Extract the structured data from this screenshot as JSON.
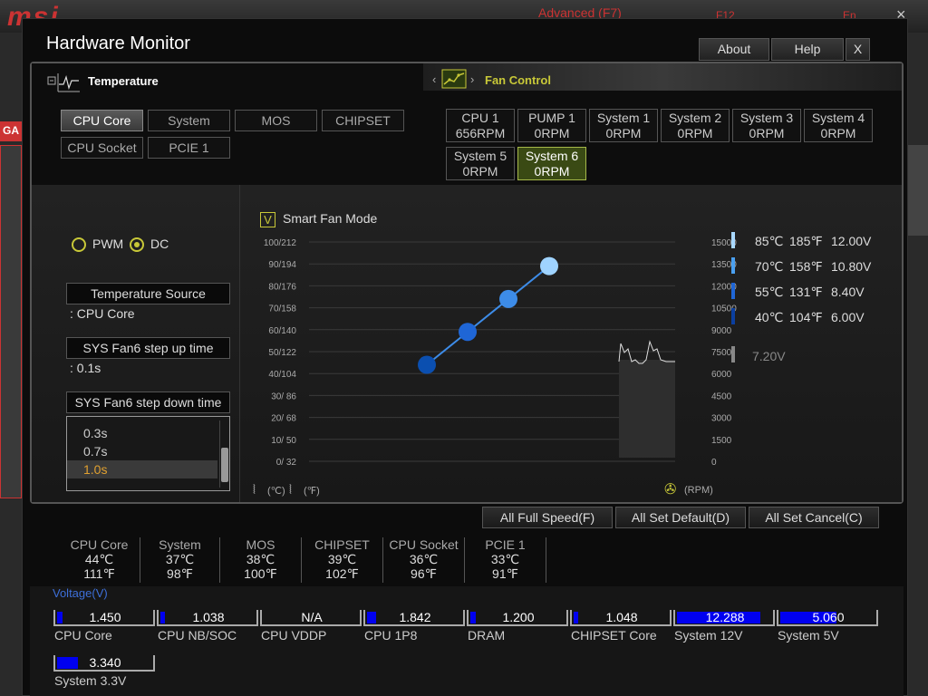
{
  "background_app": {
    "logo": "msi",
    "mode_label": "Advanced (F7)",
    "f12_label": "F12",
    "lang_label": "En",
    "close_label": "×",
    "left_badge": "GA"
  },
  "dialog": {
    "title": "Hardware Monitor",
    "about_label": "About",
    "help_label": "Help",
    "close_label": "X"
  },
  "tabs": {
    "temperature_label": "Temperature",
    "fan_control_label": "Fan Control"
  },
  "sensor_buttons": [
    {
      "label": "CPU Core",
      "selected": true
    },
    {
      "label": "System",
      "selected": false
    },
    {
      "label": "MOS",
      "selected": false
    },
    {
      "label": "CHIPSET",
      "selected": false
    },
    {
      "label": "CPU Socket",
      "selected": false
    },
    {
      "label": "PCIE 1",
      "selected": false
    }
  ],
  "fans": [
    {
      "name": "CPU 1",
      "rpm": "656RPM",
      "selected": false
    },
    {
      "name": "PUMP 1",
      "rpm": "0RPM",
      "selected": false
    },
    {
      "name": "System 1",
      "rpm": "0RPM",
      "selected": false
    },
    {
      "name": "System 2",
      "rpm": "0RPM",
      "selected": false
    },
    {
      "name": "System 3",
      "rpm": "0RPM",
      "selected": false
    },
    {
      "name": "System 4",
      "rpm": "0RPM",
      "selected": false
    },
    {
      "name": "System 5",
      "rpm": "0RPM",
      "selected": false
    },
    {
      "name": "System 6",
      "rpm": "0RPM",
      "selected": true
    }
  ],
  "fan_mode": {
    "pwm_label": "PWM",
    "dc_label": "DC",
    "selected": "DC",
    "temp_source_header": "Temperature Source",
    "temp_source_value": ": CPU Core",
    "step_up_header": "SYS Fan6 step up time",
    "step_up_value": ": 0.1s",
    "step_down_header": "SYS Fan6 step down time",
    "step_down_options": [
      "0.3s",
      "0.7s",
      "1.0s"
    ],
    "step_down_selected": "1.0s"
  },
  "smart_fan": {
    "label": "Smart Fan Mode",
    "checked_mark": "V",
    "celsius_unit": "(℃)",
    "fahrenheit_unit": "(℉)",
    "rpm_unit": "(RPM)"
  },
  "chart_data": {
    "type": "line",
    "y_left_ticks": [
      "100/212",
      "90/194",
      "80/176",
      "70/158",
      "60/140",
      "50/122",
      "40/104",
      "30/ 86",
      "20/ 68",
      "10/ 50",
      "0/ 32"
    ],
    "y_right_ticks": [
      "15000",
      "13500",
      "12000",
      "10500",
      "9000",
      "7500",
      "6000",
      "4500",
      "3000",
      "1500",
      "0"
    ],
    "ylim_temp_c": [
      0,
      100
    ],
    "ylim_rpm": [
      0,
      15000
    ],
    "series": [
      {
        "points": [
          {
            "temp_c": 40,
            "voltage": 6.0
          },
          {
            "temp_c": 55,
            "voltage": 8.4
          },
          {
            "temp_c": 70,
            "voltage": 10.8
          },
          {
            "temp_c": 85,
            "voltage": 12.0
          }
        ]
      }
    ],
    "grid": true,
    "colors": [
      "#0b4fb0",
      "#1f66d6",
      "#3d8ce8",
      "#9fd3ff"
    ]
  },
  "legend": [
    {
      "c": "85℃",
      "f": "185℉",
      "v": "12.00V",
      "color": "#a8d8ff"
    },
    {
      "c": "70℃",
      "f": "158℉",
      "v": "10.80V",
      "color": "#4aa0f0"
    },
    {
      "c": "55℃",
      "f": "131℉",
      "v": "8.40V",
      "color": "#1f66d6"
    },
    {
      "c": "40℃",
      "f": "104℉",
      "v": "6.00V",
      "color": "#0b3fa0"
    }
  ],
  "current_voltage": "7.20V",
  "actions": {
    "full_speed": "All Full Speed(F)",
    "set_default": "All Set Default(D)",
    "set_cancel": "All Set Cancel(C)"
  },
  "temperatures": [
    {
      "name": "CPU Core",
      "c": "44℃",
      "f": "111℉"
    },
    {
      "name": "System",
      "c": "37℃",
      "f": "98℉"
    },
    {
      "name": "MOS",
      "c": "38℃",
      "f": "100℉"
    },
    {
      "name": "CHIPSET",
      "c": "39℃",
      "f": "102℉"
    },
    {
      "name": "CPU Socket",
      "c": "36℃",
      "f": "96℉"
    },
    {
      "name": "PCIE 1",
      "c": "33℃",
      "f": "91℉"
    }
  ],
  "voltage_title": "Voltage(V)",
  "voltages": [
    {
      "name": "CPU Core",
      "value": "1.450",
      "fill": 0.06
    },
    {
      "name": "CPU NB/SOC",
      "value": "1.038",
      "fill": 0.05
    },
    {
      "name": "CPU VDDP",
      "value": "N/A",
      "fill": 0
    },
    {
      "name": "CPU 1P8",
      "value": "1.842",
      "fill": 0.1
    },
    {
      "name": "DRAM",
      "value": "1.200",
      "fill": 0.06
    },
    {
      "name": "CHIPSET Core",
      "value": "1.048",
      "fill": 0.05
    },
    {
      "name": "System 12V",
      "value": "12.288",
      "fill": 0.88
    },
    {
      "name": "System 5V",
      "value": "5.060",
      "fill": 0.6
    },
    {
      "name": "System 3.3V",
      "value": "3.340",
      "fill": 0.22
    }
  ]
}
